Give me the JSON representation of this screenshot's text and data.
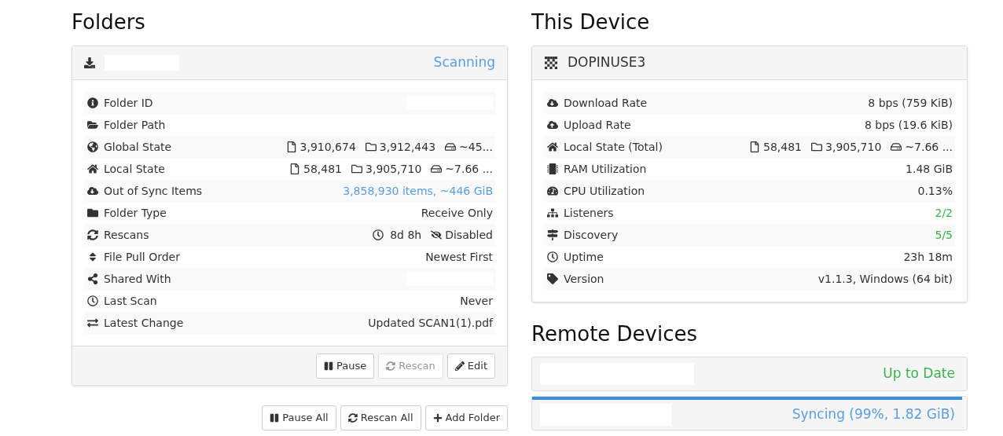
{
  "folders": {
    "heading": "Folders",
    "panel": {
      "status": "Scanning",
      "rows": [
        {
          "label": "Folder ID",
          "kind": "redacted"
        },
        {
          "label": "Folder Path",
          "kind": "redacted"
        },
        {
          "label": "Global State",
          "kind": "counts",
          "files": "3,910,674",
          "dirs": "3,912,443",
          "size": "~45..."
        },
        {
          "label": "Local State",
          "kind": "counts",
          "files": "58,481",
          "dirs": "3,905,710",
          "size": "~7.66 ..."
        },
        {
          "label": "Out of Sync Items",
          "kind": "text",
          "value": "3,858,930 items, ~446 GiB",
          "color": "#5a9ee0"
        },
        {
          "label": "Folder Type",
          "kind": "text",
          "value": "Receive Only",
          "color": "#333333"
        },
        {
          "label": "Rescans",
          "kind": "rescans",
          "interval": "8d 8h",
          "watcher": "Disabled"
        },
        {
          "label": "File Pull Order",
          "kind": "text",
          "value": "Newest First",
          "color": "#333333"
        },
        {
          "label": "Shared With",
          "kind": "redacted"
        },
        {
          "label": "Last Scan",
          "kind": "text",
          "value": "Never",
          "color": "#333333"
        },
        {
          "label": "Latest Change",
          "kind": "text",
          "value": "Updated SCAN1(1).pdf",
          "color": "#333333"
        }
      ],
      "buttons": [
        {
          "label": "Pause",
          "disabled": false
        },
        {
          "label": "Rescan",
          "disabled": true
        },
        {
          "label": "Edit",
          "disabled": false
        }
      ]
    },
    "global_buttons": [
      {
        "label": "Pause All"
      },
      {
        "label": "Rescan All"
      },
      {
        "label": "Add Folder"
      }
    ]
  },
  "this_device": {
    "heading": "This Device",
    "name": "DOPINUSE3",
    "rows": [
      {
        "label": "Download Rate",
        "kind": "text",
        "value": "8 bps (759 KiB)",
        "color": "#333333"
      },
      {
        "label": "Upload Rate",
        "kind": "text",
        "value": "8 bps (19.6 KiB)",
        "color": "#333333"
      },
      {
        "label": "Local State (Total)",
        "kind": "counts",
        "files": "58,481",
        "dirs": "3,905,710",
        "size": "~7.66 ..."
      },
      {
        "label": "RAM Utilization",
        "kind": "text",
        "value": "1.48 GiB",
        "color": "#333333"
      },
      {
        "label": "CPU Utilization",
        "kind": "text",
        "value": "0.13%",
        "color": "#333333"
      },
      {
        "label": "Listeners",
        "kind": "text",
        "value": "2/2",
        "color": "#3cb34a"
      },
      {
        "label": "Discovery",
        "kind": "text",
        "value": "5/5",
        "color": "#3cb34a"
      },
      {
        "label": "Uptime",
        "kind": "text",
        "value": "23h 18m",
        "color": "#333333"
      },
      {
        "label": "Version",
        "kind": "text",
        "value": "v1.1.3, Windows (64 bit)",
        "color": "#333333"
      }
    ]
  },
  "remote_devices": {
    "heading": "Remote Devices",
    "devices": [
      {
        "status": "Up to Date",
        "color": "#3cb34a",
        "syncing": false
      },
      {
        "status": "Syncing (99%, 1.82 GiB)",
        "color": "#5a9ee0",
        "syncing": true,
        "level": 0.99
      }
    ]
  }
}
